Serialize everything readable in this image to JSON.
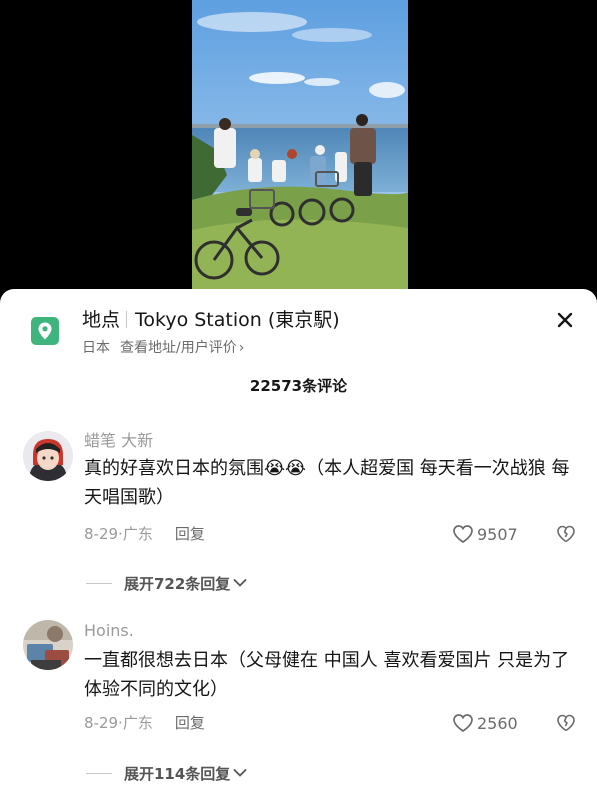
{
  "location": {
    "prefix": "地点",
    "name": "Tokyo Station (東京駅)",
    "country": "日本",
    "links": "查看地址/用户评价",
    "chevron": "›"
  },
  "comment_count": "22573条评论",
  "comments": [
    {
      "username": "蜡笔 大新",
      "text": "真的好喜欢日本的氛围😭😭（本人超爱国 每天看一次战狼 每天唱国歌）",
      "date": "8-29",
      "region": "广东",
      "reply_label": "回复",
      "likes": "9507",
      "expand_label": "展开722条回复"
    },
    {
      "username": "Hoins.",
      "text": "一直都很想去日本（父母健在 中国人 喜欢看爱国片 只是为了体验不同的文化）",
      "date": "8-29",
      "region": "广东",
      "reply_label": "回复",
      "likes": "2560",
      "expand_label": "展开114条回复"
    }
  ],
  "icons": {
    "location": "map-pin-icon",
    "close": "close-icon",
    "like": "heart-outline-icon",
    "dislike": "broken-heart-icon",
    "expand": "chevron-down-icon"
  },
  "colors": {
    "location_icon": "#3fb47c",
    "sheet_background": "#ffffff",
    "muted_text": "#9a9a9a"
  }
}
